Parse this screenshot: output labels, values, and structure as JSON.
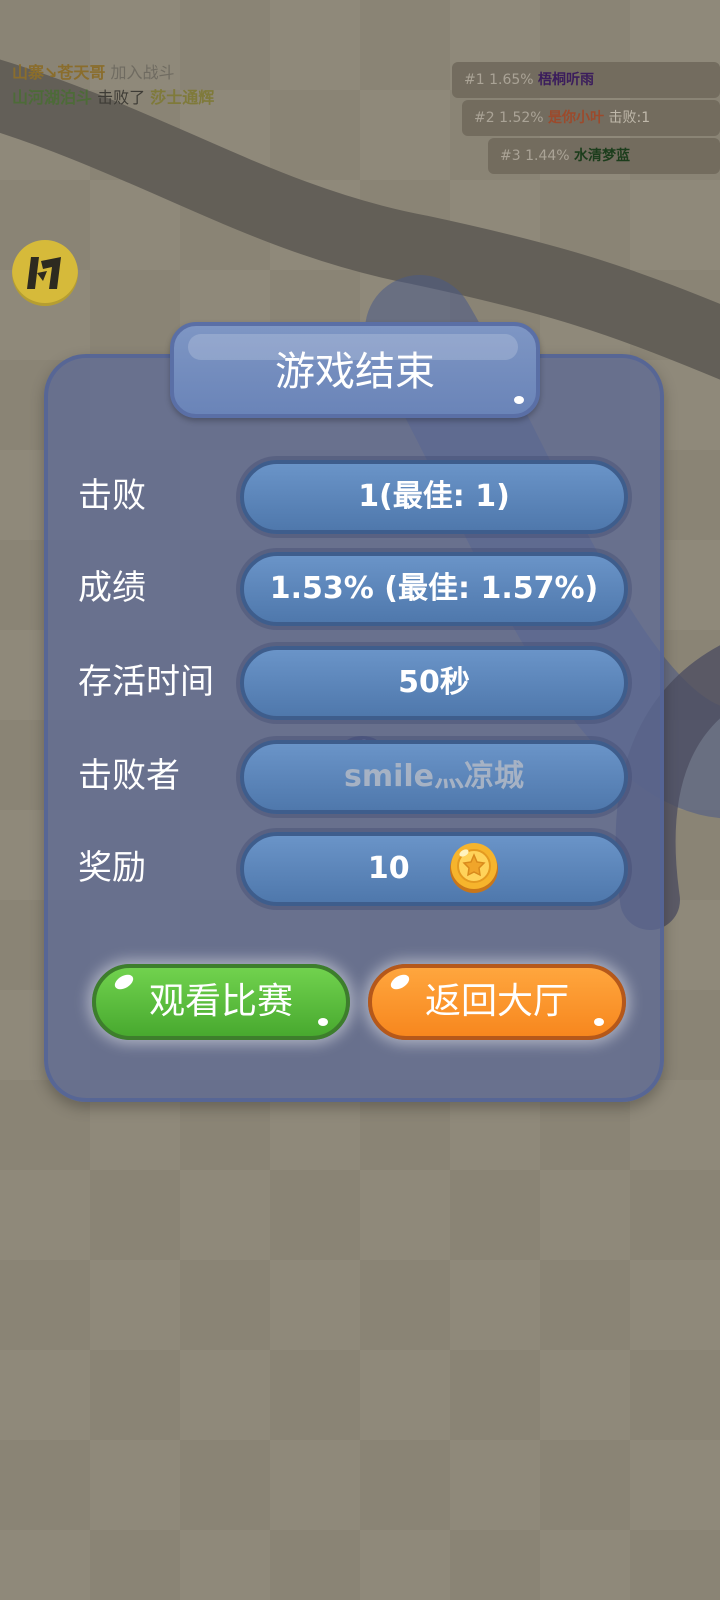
{
  "kill_feed": [
    {
      "name": "山寨↘苍天哥",
      "action": "加入战斗"
    },
    {
      "name": "山河湖泊斗",
      "action": "击败了",
      "target": "莎士通辉"
    }
  ],
  "leaderboard": [
    {
      "rank": "#1",
      "percent": "1.65%",
      "name": "梧桐听雨"
    },
    {
      "rank": "#2",
      "percent": "1.52%",
      "name": "是你小叶",
      "kills": "击败:1"
    },
    {
      "rank": "#3",
      "percent": "1.44%",
      "name": "水清梦蓝"
    }
  ],
  "dialog": {
    "title": "游戏结束",
    "rows": [
      {
        "label": "击败",
        "value": "1(最佳: 1)"
      },
      {
        "label": "成绩",
        "value": "1.53% (最佳: 1.57%)"
      },
      {
        "label": "存活时间",
        "value": "50秒"
      },
      {
        "label": "击败者",
        "value": "smile灬凉城"
      },
      {
        "label": "奖励",
        "value": "10"
      }
    ],
    "watch_button": "观看比赛",
    "back_button": "返回大厅"
  },
  "icons": {
    "logo": "game-logo-icon",
    "coin": "gold-coin-icon"
  },
  "colors": {
    "dialog_bg": "#5c6a96",
    "pill_bg": "#5a84b8",
    "watch_button": "#5bbd3c",
    "back_button": "#f7921f",
    "logo": "#d6ba3a"
  }
}
